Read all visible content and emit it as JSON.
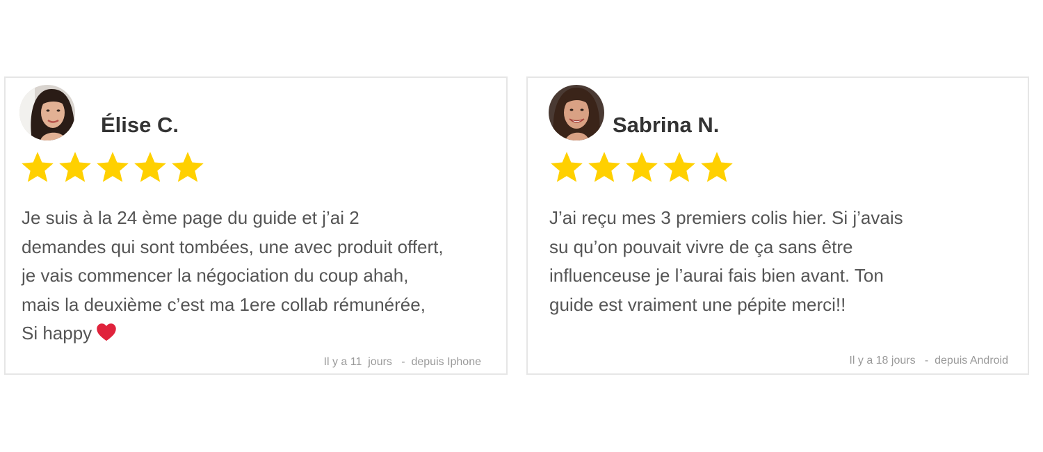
{
  "reviews": [
    {
      "name": "Élise C.",
      "rating": 5,
      "rating_max": 5,
      "text": "Je suis à la 24 ème page du guide et j’ai 2\ndemandes qui sont tombées, une avec produit offert,\nje vais commencer la négociation du coup ahah,\nmais la deuxième c’est ma 1ere collab rémunérée,\nSi happy",
      "emoji": "heart-icon",
      "meta": "Il y a 11  jours   -  depuis Iphone"
    },
    {
      "name": "Sabrina N.",
      "rating": 5,
      "rating_max": 5,
      "text": "J’ai reçu mes 3 premiers colis hier. Si j’avais\nsu qu’on pouvait vivre de ça sans être\ninfluenceuse je l’aurai fais bien avant. Ton\nguide est vraiment une pépite merci!!",
      "meta": "Il y a 18 jours   -  depuis Android"
    }
  ],
  "colors": {
    "star": "#FFD000",
    "heart": "#E0233C",
    "name": "#333333",
    "text": "#555555",
    "meta": "#9A9A9A",
    "border": "#E6E6E6"
  }
}
